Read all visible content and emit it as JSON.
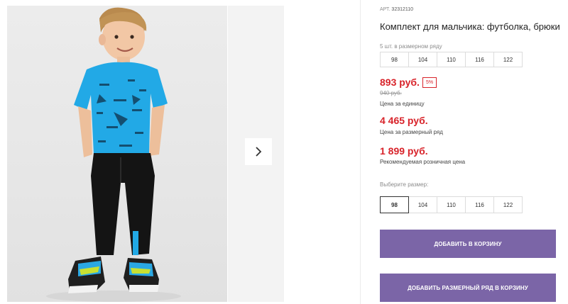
{
  "gallery": {
    "photo_alt": "Комплект для мальчика: футболка, брюки",
    "next_arrow": "chevron-right-icon"
  },
  "product": {
    "article_label": "АРТ.",
    "article_number": "32312110",
    "title": "Комплект для мальчика: футболка, брюки",
    "row_note": "5 шт. в размерном ряду",
    "row_sizes": [
      "98",
      "104",
      "110",
      "116",
      "122"
    ],
    "unit_price": "893 руб.",
    "discount_badge": "5%",
    "old_price": "940 руб.",
    "unit_price_label": "Цена за единицу",
    "row_price": "4 465 руб.",
    "row_price_label": "Цена за размерный ряд",
    "retail_price": "1 899 руб.",
    "retail_price_label": "Рекомендуемая розничная цена",
    "choose_size_label": "Выберите размер:",
    "size_options": [
      "98",
      "104",
      "110",
      "116",
      "122"
    ],
    "selected_size": "98",
    "add_to_cart": "ДОБАВИТЬ В КОРЗИНУ",
    "add_row_to_cart": "ДОБАВИТЬ РАЗМЕРНЫЙ РЯД В КОРЗИНУ"
  },
  "colors": {
    "accent": "#7b65a7",
    "price_red": "#d8232a",
    "tshirt": "#22a9e6",
    "pants": "#141414"
  }
}
